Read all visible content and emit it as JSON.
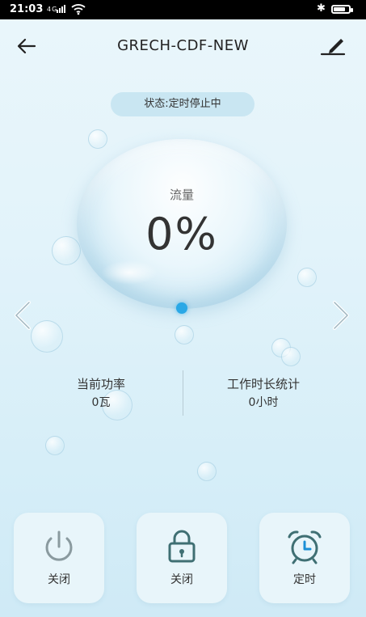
{
  "status_bar": {
    "time": "21:03",
    "signal": "4G",
    "bluetooth": "✱",
    "battery_level": 0.8
  },
  "header": {
    "title": "GRECH-CDF-NEW",
    "back_icon": "arrow-left-icon",
    "edit_icon": "edit-pen-icon"
  },
  "device_status": {
    "text": "状态:定时停止中"
  },
  "gauge": {
    "label": "流量",
    "value": "0%",
    "indicator_color": "#2aa8e6"
  },
  "stats": {
    "power": {
      "label": "当前功率",
      "value": "0瓦"
    },
    "runtime": {
      "label": "工作时长统计",
      "value": "0小时"
    }
  },
  "controls": [
    {
      "label": "关闭",
      "icon": "power-icon"
    },
    {
      "label": "关闭",
      "icon": "lock-icon"
    },
    {
      "label": "定时",
      "icon": "alarm-clock-icon"
    }
  ],
  "colors": {
    "accent": "#2aa8e6",
    "background": "#e2f3fa",
    "icon_gray": "#8a9a9f",
    "icon_teal": "#3f6f73",
    "icon_clock_blue": "#1a8fd6"
  }
}
